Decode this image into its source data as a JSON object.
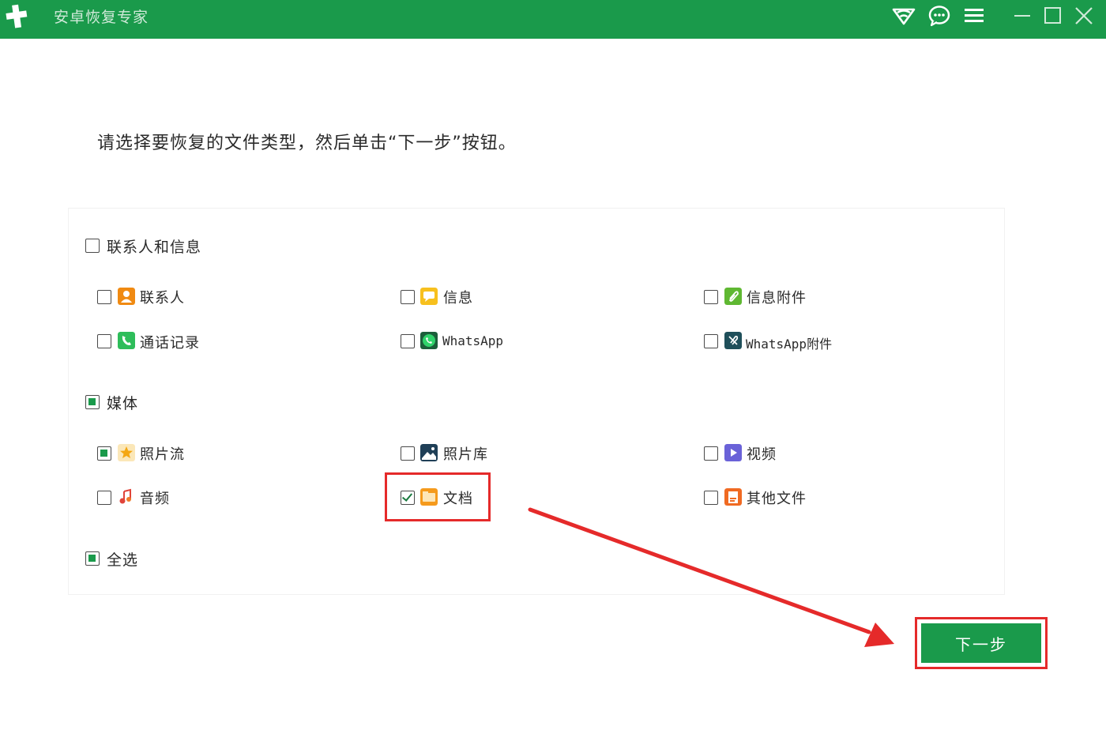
{
  "window": {
    "title": "安卓恢复专家",
    "brand_color": "#1a9a4b",
    "controls": [
      "wifi-icon",
      "chat-icon",
      "menu-icon",
      "minimize-icon",
      "maximize-icon",
      "close-icon"
    ]
  },
  "instruction": "请选择要恢复的文件类型，然后单击“下一步”按钮。",
  "groups": [
    {
      "label": "联系人和信息",
      "state": "unchecked",
      "items": [
        {
          "label": "联系人",
          "icon": "contact-icon",
          "state": "unchecked"
        },
        {
          "label": "信息",
          "icon": "message-icon",
          "state": "unchecked"
        },
        {
          "label": "信息附件",
          "icon": "attachment-icon",
          "state": "unchecked"
        },
        {
          "label": "通话记录",
          "icon": "phone-icon",
          "state": "unchecked"
        },
        {
          "label": "WhatsApp",
          "icon": "whatsapp-icon",
          "state": "unchecked"
        },
        {
          "label": "WhatsApp附件",
          "icon": "whatsapp-attachment-icon",
          "state": "unchecked"
        }
      ]
    },
    {
      "label": "媒体",
      "state": "partial",
      "items": [
        {
          "label": "照片流",
          "icon": "star-icon",
          "state": "partial"
        },
        {
          "label": "照片库",
          "icon": "image-icon",
          "state": "unchecked"
        },
        {
          "label": "视频",
          "icon": "video-icon",
          "state": "unchecked"
        },
        {
          "label": "音频",
          "icon": "music-icon",
          "state": "unchecked"
        },
        {
          "label": "文档",
          "icon": "folder-icon",
          "state": "checked"
        },
        {
          "label": "其他文件",
          "icon": "file-icon",
          "state": "unchecked"
        }
      ]
    }
  ],
  "select_all": {
    "label": "全选",
    "state": "partial"
  },
  "next_button": {
    "label": "下一步"
  },
  "annotation_color": "#e52a2a"
}
